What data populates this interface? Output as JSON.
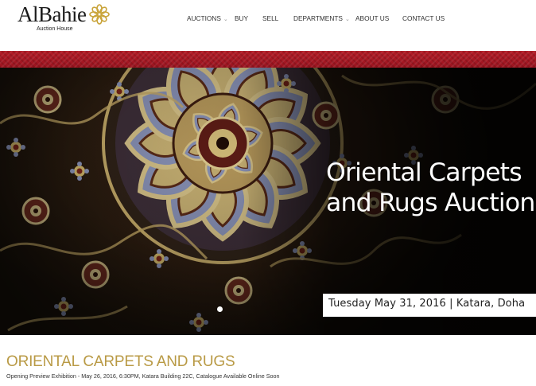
{
  "brand": {
    "name": "AlBahie",
    "tagline": "Auction House"
  },
  "nav": {
    "items": [
      {
        "label": "AUCTIONS",
        "dropdown": true
      },
      {
        "label": "BUY",
        "dropdown": false
      },
      {
        "label": "SELL",
        "dropdown": false
      },
      {
        "label": "DEPARTMENTS",
        "dropdown": true
      },
      {
        "label": "ABOUT US",
        "dropdown": false
      },
      {
        "label": "CONTACT US",
        "dropdown": false
      }
    ]
  },
  "hero": {
    "title_line1": "Oriental Carpets",
    "title_line2": "and Rugs Auction",
    "date_text": "Tuesday May 31, 2016 | Katara, Doha",
    "slide_indicator": "slide-dot",
    "background": "oriental-carpet-image"
  },
  "section": {
    "title": "ORIENTAL CARPETS AND RUGS",
    "subtitle": "Opening Preview Exhibition - May 26, 2016, 6:30PM, Katara Building 22C, Catalogue Available Online Soon"
  },
  "colors": {
    "accent_gold": "#b99a45",
    "ribbon_red": "#a8182a",
    "logo_gold": "#c9a43a"
  }
}
